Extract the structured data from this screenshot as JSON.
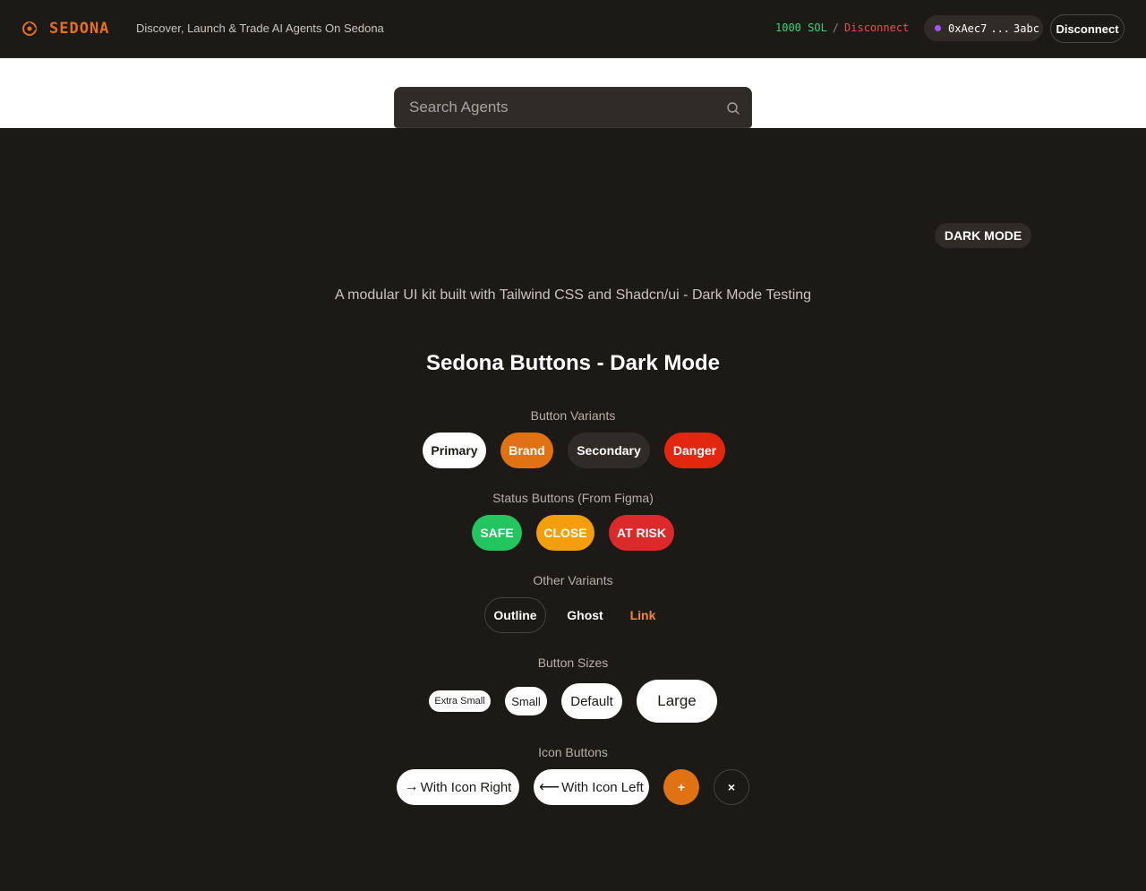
{
  "header": {
    "logo_text": "SEDONA",
    "tagline": "Discover, Launch & Trade AI Agents On Sedona",
    "balance": "1000 SOL",
    "separator": "/",
    "disconnect_link": "Disconnect",
    "address_start": "0xAec7",
    "address_ellipsis": "...",
    "address_end": "3abc",
    "disconnect_button": "Disconnect"
  },
  "search": {
    "placeholder": "Search Agents"
  },
  "badge": "DARK MODE",
  "subtitle": "A modular UI kit built with Tailwind CSS and Shadcn/ui - Dark Mode Testing",
  "title": "Sedona Buttons - Dark Mode",
  "sections": {
    "variants": {
      "label": "Button Variants",
      "buttons": [
        "Primary",
        "Brand",
        "Secondary",
        "Danger"
      ]
    },
    "status": {
      "label": "Status Buttons (From Figma)",
      "buttons": [
        "SAFE",
        "CLOSE",
        "AT RISK"
      ]
    },
    "other": {
      "label": "Other Variants",
      "buttons": [
        "Outline",
        "Ghost",
        "Link"
      ]
    },
    "sizes": {
      "label": "Button Sizes",
      "buttons": [
        "Extra Small",
        "Small",
        "Default",
        "Large"
      ]
    },
    "icons": {
      "label": "Icon Buttons",
      "buttons": [
        "With Icon Right",
        "With Icon Left",
        "+",
        "×"
      ]
    }
  },
  "icons": {
    "arrow_right": "→",
    "arrow_left": "⟵"
  },
  "colors": {
    "brand": "#e07212",
    "background": "#1c1a17",
    "danger": "#e3270f",
    "safe": "#22c55e",
    "close": "#f59e0b",
    "risk": "#dc2a2a"
  }
}
